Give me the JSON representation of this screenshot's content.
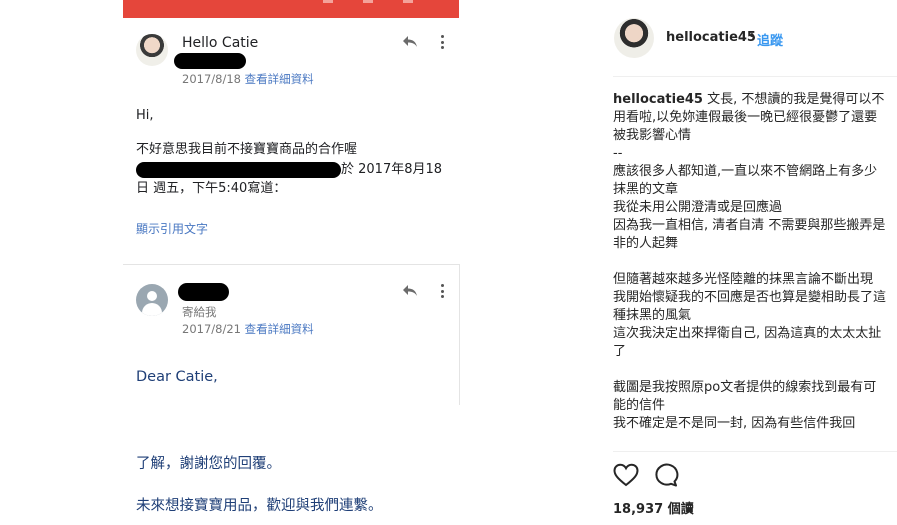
{
  "email1": {
    "sender": "Hello Catie",
    "date": "2017/8/18",
    "details_link": "查看詳細資料",
    "greeting": "Hi,",
    "body_line1": "不好意思我目前不接寶寶商品的合作喔",
    "body_line2_suffix": "於 2017年8月18",
    "body_line3": "日 週五，下午5:40寫道：",
    "show_quoted": "顯示引用文字"
  },
  "email2": {
    "to_label": "寄給我",
    "date": "2017/8/21",
    "details_link": "查看詳細資料",
    "greeting": "Dear Catie,",
    "line1": "了解，謝謝您的回覆。",
    "line2": "未來想接寶寶用品，歡迎與我們連繫。"
  },
  "sidebar": {
    "username": "hellocatie45",
    "dot": "•",
    "follow": "追蹤",
    "caption_username": "hellocatie45",
    "caption_first": " 文長, 不想讀的我是覺得可以不用看啦,以免妳連假最後一晚已經很憂鬱了還要被我影響心情",
    "caption_rest": "--\n應該很多人都知道,一直以來不管網路上有多少抹黑的文章\n我從未用公開澄清或是回應過\n因為我一直相信, 清者自清 不需要與那些搬弄是非的人起舞\n\n但隨著越來越多光怪陸離的抹黑言論不斷出現\n我開始懷疑我的不回應是否也算是變相助長了這種抹黑的風氣\n這次我決定出來捍衛自己, 因為這真的太太太扯了\n\n截圖是我按照原po文者提供的線索找到最有可能的信件\n我不確定是不是同一封, 因為有些信件我回",
    "views_count": "18,937",
    "views_label": "個讀"
  },
  "colors": {
    "header_red": "#e5463b",
    "link_blue": "#4a78c2",
    "follow_blue": "#3897f0"
  }
}
